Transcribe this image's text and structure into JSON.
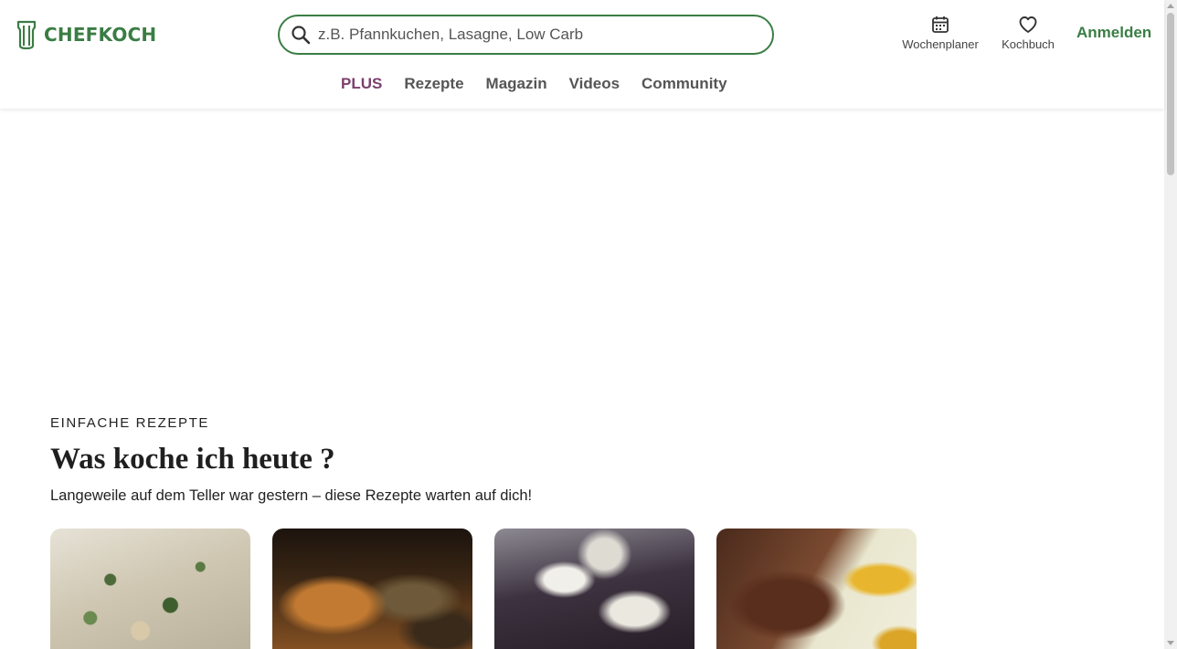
{
  "brand": {
    "name": "CHEFKOCH",
    "color": "#3a7d44"
  },
  "search": {
    "placeholder": "z.B. Pfannkuchen, Lasagne, Low Carb",
    "value": ""
  },
  "header_tools": {
    "planner": {
      "label": "Wochenplaner",
      "icon": "calendar-icon"
    },
    "cookbook": {
      "label": "Kochbuch",
      "icon": "heart-icon"
    },
    "login": "Anmelden"
  },
  "nav": {
    "items": [
      {
        "label": "PLUS",
        "color": "#7b3f6e"
      },
      {
        "label": "Rezepte"
      },
      {
        "label": "Magazin"
      },
      {
        "label": "Videos"
      },
      {
        "label": "Community"
      }
    ]
  },
  "section": {
    "eyebrow": "EINFACHE REZEPTE",
    "title": "Was koche ich heute ?",
    "subtitle": "Langeweile auf dem Teller war gestern – diese Rezepte warten auf dich!"
  },
  "cards": [
    {
      "image": "recipe-photo-creamy-soup"
    },
    {
      "image": "recipe-photo-pie"
    },
    {
      "image": "recipe-photo-cheese-gratin"
    },
    {
      "image": "recipe-photo-meat-with-potatoes"
    }
  ]
}
